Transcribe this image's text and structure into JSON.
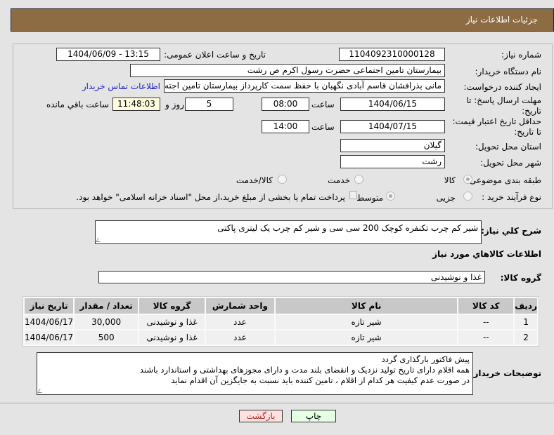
{
  "header": {
    "title": "جزئیات اطلاعات نیاز"
  },
  "form": {
    "need_number_label": "شماره نیاز:",
    "need_number": "1104092310000128",
    "announce_label": "تاریخ و ساعت اعلان عمومی:",
    "announce_value": "1404/06/09 - 13:15",
    "buyer_org_label": "نام دستگاه خریدار:",
    "buyer_org": "بیمارستان  تامین اجتماعی حضرت رسول اکرم ص رشت",
    "requester_label": "ایجاد کننده درخواست:",
    "requester": "مانی بذرافشان قاسم آبادی نگهبان با حفظ سمت کارپرداز بیمارستان  تامین اجته",
    "contact_link": "اطلاعات تماس خریدار",
    "deadline_label": "مهلت ارسال پاسخ: تا تاریخ:",
    "deadline_date": "1404/06/15",
    "time_label": "ساعت",
    "deadline_time": "08:00",
    "days": "5",
    "days_label": "روز و",
    "remaining": "11:48:03",
    "remaining_label": "ساعت باقي مانده",
    "validity_label": "حداقل تاریخ اعتبار قیمت: تا تاریخ:",
    "validity_date": "1404/07/15",
    "validity_time": "14:00",
    "province_label": "استان محل تحویل:",
    "province": "گیلان",
    "city_label": "شهر محل تحویل:",
    "city": "رشت",
    "category_label": "طبقه بندی موضوعی:",
    "category_options": [
      "کالا",
      "خدمت",
      "کالا/خدمت"
    ],
    "process_label": "نوع فرآیند خرید :",
    "process_options": [
      "جزیی",
      "متوسط"
    ],
    "payment_note": "پرداخت تمام یا بخشی از مبلغ خرید،از محل \"اسناد خزانه اسلامی\" خواهد بود."
  },
  "description": {
    "label": "شرح کلي نیاز:",
    "value": "شیر کم چرب تکنفره کوچک 200 سی سی و شیر کم چرب یک لیتری پاکتی"
  },
  "goods": {
    "title": "اطلاعات کالاهاي مورد نیاز",
    "group_label": "گروه کالا:",
    "group_value": "غذا و نوشیدنی",
    "columns": [
      "ردیف",
      "کد کالا",
      "نام کالا",
      "واحد شمارش",
      "گروه کالا",
      "تعداد / مقدار",
      "تاریخ نیاز"
    ],
    "rows": [
      [
        "1",
        "--",
        "شیر تازه",
        "عدد",
        "غذا و نوشیدنی",
        "30,000",
        "1404/06/17"
      ],
      [
        "2",
        "--",
        "شیر تازه",
        "عدد",
        "غذا و نوشیدنی",
        "500",
        "1404/06/17"
      ]
    ]
  },
  "notes": {
    "label": "توضیحات خریدار:",
    "lines": [
      "پیش فاکتور بارگذاری گردد",
      "همه اقلام دارای تاریخ تولید نزدیک و انقضای بلند مدت و دارای مجوزهای بهداشتی و استاندارد باشند",
      "در صورت عدم کیفیت هر کدام از اقلام ، تامین کننده باید نسبت به جایگزین آن اقدام نماید"
    ]
  },
  "buttons": {
    "back": "بازگشت",
    "print": "چاپ"
  }
}
